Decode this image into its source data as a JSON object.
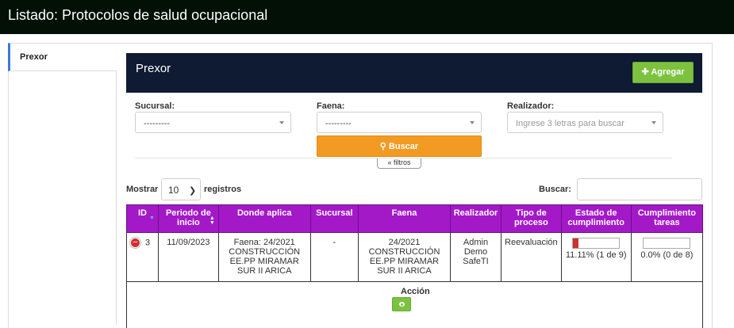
{
  "header": {
    "title": "Listado: Protocolos de salud ocupacional"
  },
  "sidebar": {
    "tabs": [
      {
        "label": "Prexor"
      }
    ]
  },
  "panel": {
    "title": "Prexor",
    "add_button": "Agregar",
    "add_icon": "plus-icon"
  },
  "filters": {
    "sucursal": {
      "label": "Sucursal:",
      "value": "---------"
    },
    "faena": {
      "label": "Faena:",
      "value": "---------"
    },
    "realizador": {
      "label": "Realizador:",
      "placeholder": "Ingrese 3 letras para buscar"
    },
    "search_button": "Buscar",
    "toggle": "« filtros"
  },
  "table_controls": {
    "show_label": "Mostrar",
    "page_size": "10",
    "records_label": "registros",
    "search_label": "Buscar:"
  },
  "table": {
    "headers": {
      "id": "ID",
      "periodo": "Periodo de inicio",
      "donde": "Donde aplica",
      "sucursal": "Sucursal",
      "faena": "Faena",
      "realizador": "Realizador",
      "tipo": "Tipo de proceso",
      "estado": "Estado de cumplimiento",
      "cumplimiento": "Cumplimiento tareas"
    },
    "rows": [
      {
        "id": "3",
        "periodo": "11/09/2023",
        "donde": "Faena: 24/2021 CONSTRUCCIÓN EE.PP MIRAMAR SUR II ARICA",
        "sucursal": "-",
        "faena": "24/2021 CONSTRUCCIÓN EE.PP MIRAMAR SUR II ARICA",
        "realizador": "Admin Demo SafeTI",
        "tipo": "Reevaluación",
        "estado_text": "11.11% (1 de 9)",
        "estado_fraction": 0.1111,
        "cumplimiento_text": "0.0% (0 de 8)",
        "cumplimiento_fraction": 0.0
      }
    ],
    "detail": {
      "label": "Acción",
      "action_icon": "eye-icon"
    }
  },
  "colors": {
    "topbar": "#031006",
    "panel": "#0f1a33",
    "add": "#7cc23f",
    "search": "#f39a23",
    "table_header": "#a319c8",
    "progress": "#d32f2f"
  }
}
